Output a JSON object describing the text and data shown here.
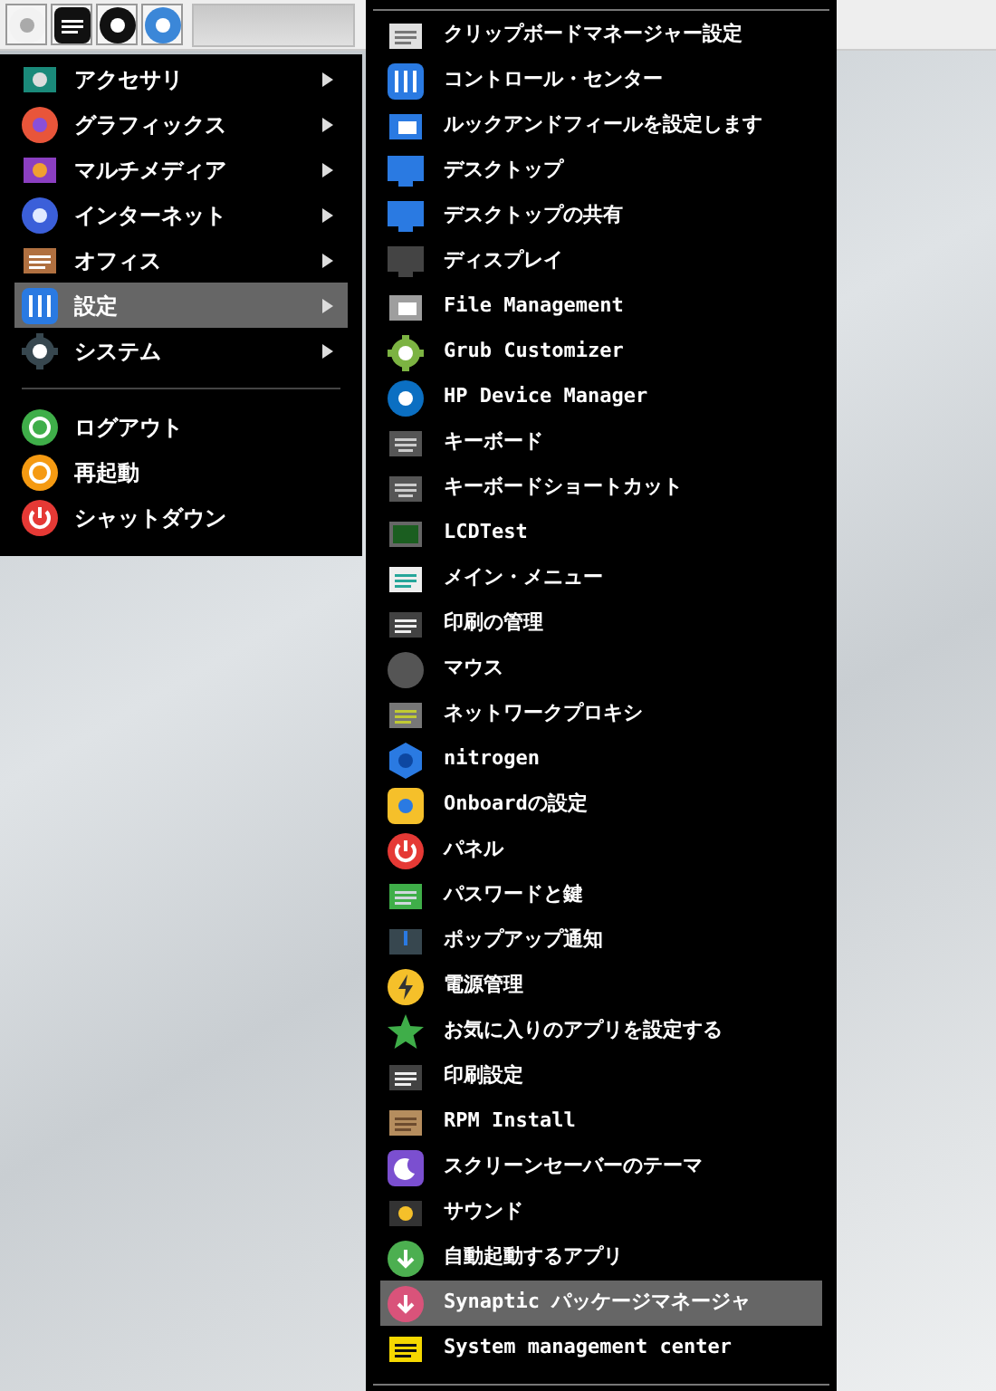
{
  "taskbar": {
    "launchers": [
      {
        "kind": "app"
      },
      {
        "kind": "terminal"
      },
      {
        "kind": "browser"
      },
      {
        "kind": "mail"
      }
    ]
  },
  "main_menu": {
    "items": [
      {
        "label": "アクセサリ",
        "has_submenu": true,
        "selected": false
      },
      {
        "label": "グラフィックス",
        "has_submenu": true,
        "selected": false
      },
      {
        "label": "マルチメディア",
        "has_submenu": true,
        "selected": false
      },
      {
        "label": "インターネット",
        "has_submenu": true,
        "selected": false
      },
      {
        "label": "オフィス",
        "has_submenu": true,
        "selected": false
      },
      {
        "label": "設定",
        "has_submenu": true,
        "selected": true
      },
      {
        "label": "システム",
        "has_submenu": true,
        "selected": false
      }
    ],
    "session_items": [
      {
        "label": "ログアウト"
      },
      {
        "label": "再起動"
      },
      {
        "label": "シャットダウン"
      }
    ]
  },
  "submenu": {
    "items": [
      {
        "label": "クリップボードマネージャー設定",
        "selected": false
      },
      {
        "label": "コントロール・センター",
        "selected": false
      },
      {
        "label": "ルックアンドフィールを設定します",
        "selected": false
      },
      {
        "label": "デスクトップ",
        "selected": false
      },
      {
        "label": "デスクトップの共有",
        "selected": false
      },
      {
        "label": "ディスプレイ",
        "selected": false
      },
      {
        "label": "File Management",
        "selected": false
      },
      {
        "label": "Grub Customizer",
        "selected": false
      },
      {
        "label": "HP Device Manager",
        "selected": false
      },
      {
        "label": "キーボード",
        "selected": false
      },
      {
        "label": "キーボードショートカット",
        "selected": false
      },
      {
        "label": "LCDTest",
        "selected": false
      },
      {
        "label": "メイン・メニュー",
        "selected": false
      },
      {
        "label": "印刷の管理",
        "selected": false
      },
      {
        "label": "マウス",
        "selected": false
      },
      {
        "label": "ネットワークプロキシ",
        "selected": false
      },
      {
        "label": "nitrogen",
        "selected": false
      },
      {
        "label": "Onboardの設定",
        "selected": false
      },
      {
        "label": "パネル",
        "selected": false
      },
      {
        "label": "パスワードと鍵",
        "selected": false
      },
      {
        "label": "ポップアップ通知",
        "selected": false
      },
      {
        "label": "電源管理",
        "selected": false
      },
      {
        "label": "お気に入りのアプリを設定する",
        "selected": false
      },
      {
        "label": "印刷設定",
        "selected": false
      },
      {
        "label": "RPM Install",
        "selected": false
      },
      {
        "label": "スクリーンセーバーのテーマ",
        "selected": false
      },
      {
        "label": "サウンド",
        "selected": false
      },
      {
        "label": "自動起動するアプリ",
        "selected": false
      },
      {
        "label": "Synaptic パッケージマネージャ",
        "selected": true
      },
      {
        "label": "System management center",
        "selected": false
      }
    ]
  }
}
